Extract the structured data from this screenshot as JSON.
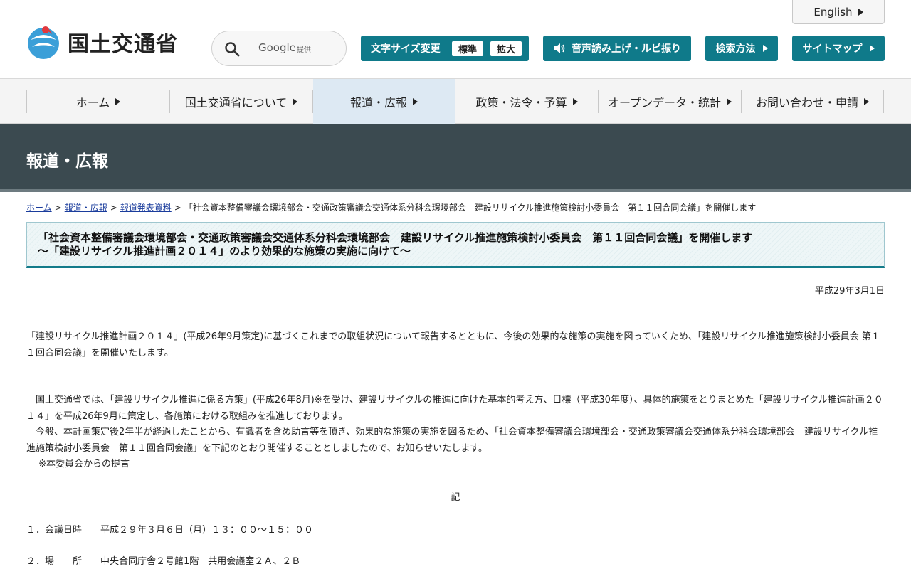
{
  "header": {
    "logo_text": "国土交通省",
    "english_label": "English",
    "search": {
      "brand": "Google",
      "sub": "提供"
    },
    "font_size": {
      "label": "文字サイズ変更",
      "standard": "標準",
      "large": "拡大"
    },
    "voice_label": "音声読み上げ・ルビ振り",
    "howto_label": "検索方法",
    "sitemap_label": "サイトマップ"
  },
  "nav": {
    "items": [
      {
        "label": "ホーム"
      },
      {
        "label": "国土交通省について"
      },
      {
        "label": "報道・広報"
      },
      {
        "label": "政策・法令・予算"
      },
      {
        "label": "オープンデータ・統計"
      },
      {
        "label": "お問い合わせ・申請"
      }
    ]
  },
  "banner": {
    "title": "報道・広報"
  },
  "breadcrumb": {
    "home": "ホーム",
    "press": "報道・広報",
    "releases": "報道発表資料",
    "current": "「社会資本整備審議会環境部会・交通政策審議会交通体系分科会環境部会　建設リサイクル推進施策検討小委員会　第１１回合同会議」を開催します"
  },
  "heading": {
    "line1": "「社会資本整備審議会環境部会・交通政策審議会交通体系分科会環境部会　建設リサイクル推進施策検討小委員会　第１１回合同会議」を開催します",
    "line2": "～「建設リサイクル推進計画２０１４」のより効果的な施策の実施に向けて～"
  },
  "date": "平成29年3月1日",
  "body": {
    "p1": "「建設リサイクル推進計画２０１４」(平成26年9月策定)に基づくこれまでの取組状況について報告するとともに、今後の効果的な施策の実施を図っていくため、「建設リサイクル推進施策検討小委員会 第１１回合同会議」を開催いたします。",
    "p2": "　国土交通省では、「建設リサイクル推進に係る方策」(平成26年8月)※を受け、建設リサイクルの推進に向けた基本的考え方、目標（平成30年度）、具体的施策をとりまとめた「建設リサイクル推進計画２０１４」を平成26年9月に策定し、各施策における取組みを推進しております。",
    "p3": "　今般、本計画策定後2年半が経過したことから、有識者を含め助言等を頂き、効果的な施策の実施を図るため、「社会資本整備審議会環境部会・交通政策審議会交通体系分科会環境部会　建設リサイクル推進施策検討小委員会　第１１回合同会議」を下記のとおり開催することとしましたので、お知らせいたします。",
    "p4": "　 ※本委員会からの提言",
    "ki": "記",
    "item1": "１．会議日時　　平成２９年３月６日（月）１３：００～１５：００",
    "item2": "２．場　　所　　中央合同庁舎２号館1階　共用会議室２Ａ、２Ｂ"
  },
  "colors": {
    "accent": "#0f7a8a",
    "banner": "#3b4a50",
    "nav_active": "#dde9f3",
    "link": "#1a3c9c"
  }
}
